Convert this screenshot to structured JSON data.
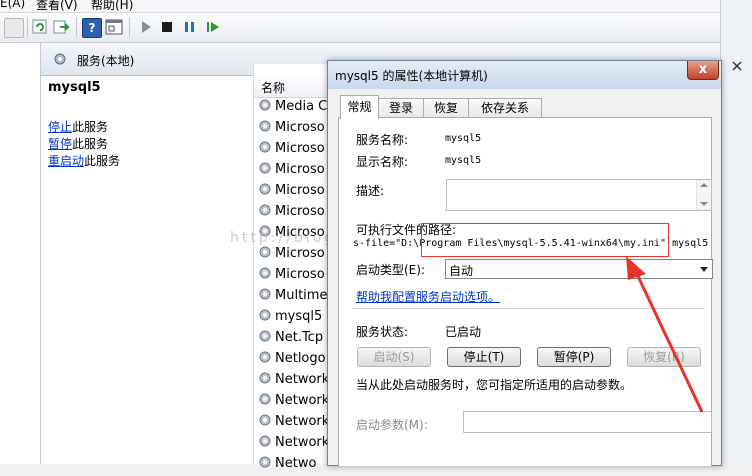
{
  "menu": {
    "item1": "E(A)",
    "item2": "查看(V)",
    "item3": "帮助(H)"
  },
  "header": {
    "title": "服务(本地)"
  },
  "description": {
    "service_name": "mysql5",
    "stop_link": "停止",
    "stop_rest": "此服务",
    "pause_link": "暂停",
    "pause_rest": "此服务",
    "restart_link": "重启动",
    "restart_rest": "此服务"
  },
  "list": {
    "column_name": "名称",
    "rows": [
      "Media C",
      "Microso",
      "Microso",
      "Microso",
      "Microso",
      "Microso",
      "Microso",
      "Microso",
      "Microso",
      "Multime",
      "mysql5",
      "Net.Tcp",
      "Netlogo",
      "Network",
      "Network",
      "Network",
      "Network",
      "Netwo"
    ]
  },
  "watermark": "http://blog.csdn.net/",
  "dialog": {
    "title": "mysql5 的属性(本地计算机)",
    "close": "x",
    "tabs": [
      "常规",
      "登录",
      "恢复",
      "依存关系"
    ],
    "service_name_label": "服务名称:",
    "service_name_value": "mysql5",
    "display_name_label": "显示名称:",
    "display_name_value": "mysql5",
    "description_label": "描述:",
    "exe_path_label": "可执行文件的路径:",
    "exe_path_value": "s-file=\"D:\\Program Files\\mysql-5.5.41-winx64\\my.ini\" mysql5",
    "startup_type_label": "启动类型(E):",
    "startup_type_value": "自动",
    "help_link": "帮助我配置服务启动选项。",
    "status_label": "服务状态:",
    "status_value": "已启动",
    "buttons": {
      "start": "启动(S)",
      "stop": "停止(T)",
      "pause": "暂停(P)",
      "resume": "恢复(R)"
    },
    "start_params_hint": "当从此处启动服务时，您可指定所适用的启动参数。",
    "start_params_label": "启动参数(M):"
  },
  "colors": {
    "accent": "#0033cc",
    "highlight": "#e8322c"
  }
}
